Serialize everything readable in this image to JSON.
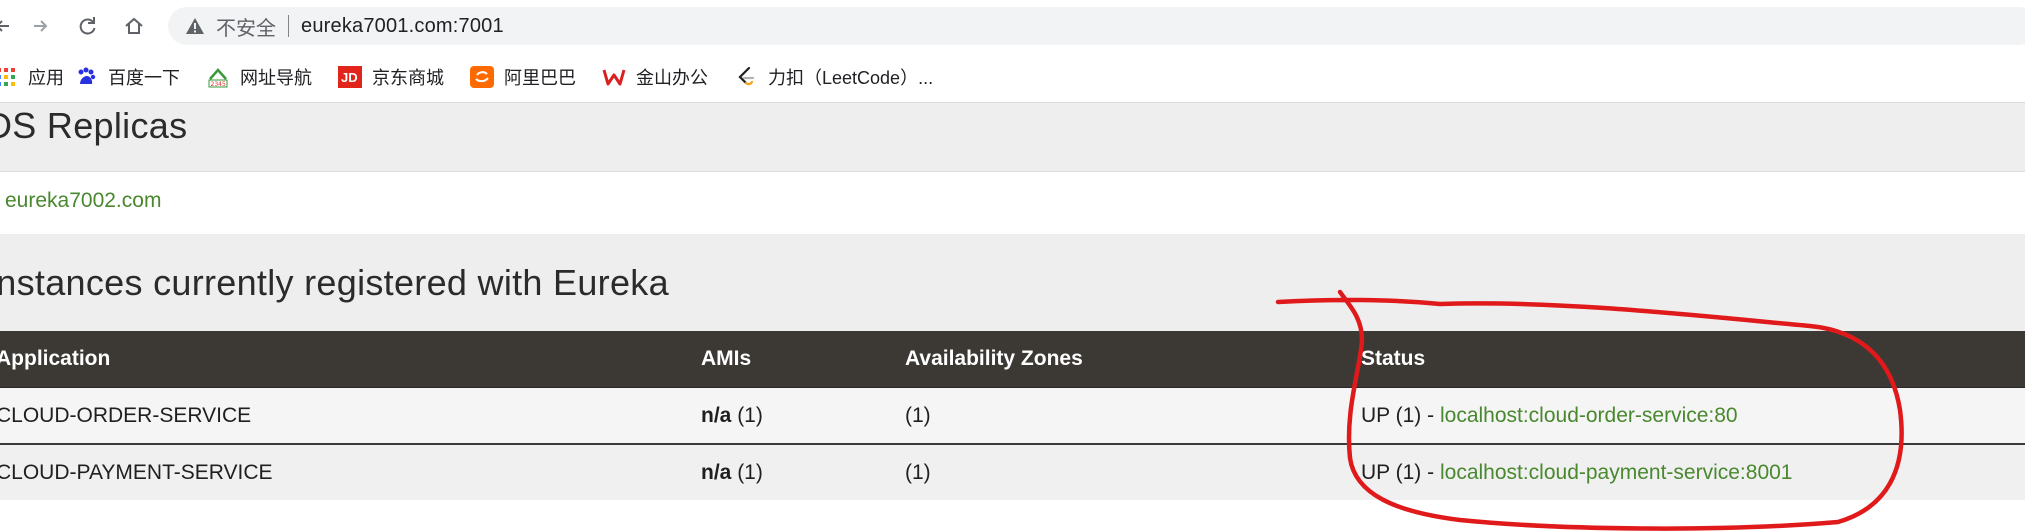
{
  "browser": {
    "security_label": "不安全",
    "url": "eureka7001.com:7001",
    "bookmarks": [
      {
        "label": "应用",
        "icon": "apps-icon"
      },
      {
        "label": "百度一下",
        "icon": "baidu-icon"
      },
      {
        "label": "网址导航",
        "icon": "hao123-icon"
      },
      {
        "label": "京东商城",
        "icon": "jd-icon"
      },
      {
        "label": "阿里巴巴",
        "icon": "alibaba-icon"
      },
      {
        "label": "金山办公",
        "icon": "wps-icon"
      },
      {
        "label": "力扣（LeetCode）...",
        "icon": "leetcode-icon"
      }
    ]
  },
  "page": {
    "replicas_heading": "DS Replicas",
    "replica_link": "eureka7002.com",
    "instances_heading": "Instances currently registered with Eureka",
    "table": {
      "headers": [
        "Application",
        "AMIs",
        "Availability Zones",
        "Status"
      ],
      "rows": [
        {
          "application": "CLOUD-ORDER-SERVICE",
          "amis_value": "n/a",
          "amis_count": "(1)",
          "zones": "(1)",
          "status_prefix": "UP (1) - ",
          "status_link": "localhost:cloud-order-service:80"
        },
        {
          "application": "CLOUD-PAYMENT-SERVICE",
          "amis_value": "n/a",
          "amis_count": "(1)",
          "zones": "(1)",
          "status_prefix": "UP (1) - ",
          "status_link": "localhost:cloud-payment-service:8001"
        }
      ]
    }
  },
  "colors": {
    "link": "#49882f",
    "header_bg": "#3c3834",
    "band_bg": "#eeeeee",
    "annotation": "#e0191b"
  }
}
